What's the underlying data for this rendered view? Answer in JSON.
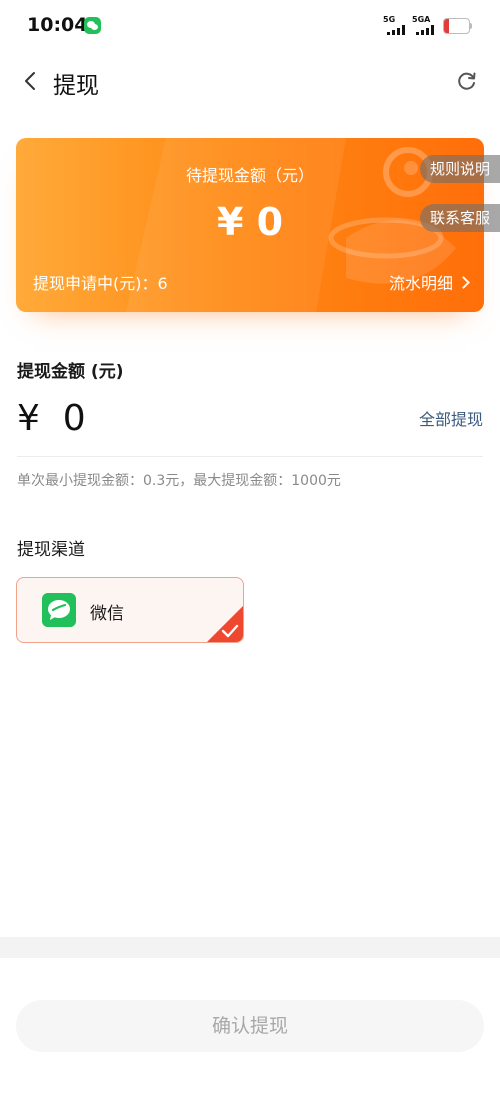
{
  "status_bar": {
    "time": "10:04",
    "signal_1_label": "5G",
    "signal_2_label": "5GA",
    "battery_text": "20",
    "battery_level": 0.2
  },
  "nav": {
    "title": "提现"
  },
  "balance_card": {
    "label": "待提现金额（元）",
    "amount": "¥ 0",
    "pending": "提现申请中(元)：6",
    "details_link": "流水明细"
  },
  "side_tabs": {
    "rules": "规则说明",
    "service": "联系客服"
  },
  "withdraw": {
    "section_title": "提现金额 (元)",
    "amount_value": "¥  0",
    "withdraw_all": "全部提现",
    "limit_note": "单次最小提现金额：0.3元，最大提现金额：1000元"
  },
  "channel": {
    "section_title": "提现渠道",
    "option_label": "微信"
  },
  "confirm_button": "确认提现",
  "colors": {
    "card_start": "#ffaa3a",
    "card_end": "#ff6e0a",
    "wechat_green": "#22c05a",
    "check_red": "#f0472f",
    "link_blue": "#3a5a80",
    "battery_red": "#e23b3b"
  }
}
